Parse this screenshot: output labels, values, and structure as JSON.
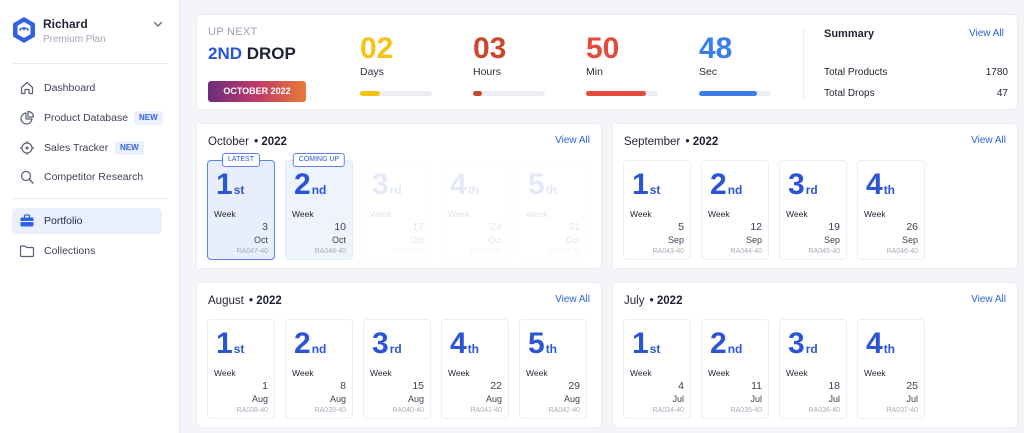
{
  "user": {
    "name": "Richard",
    "plan": "Premium Plan"
  },
  "nav": [
    {
      "label": "Dashboard",
      "icon": "home-icon",
      "badge": ""
    },
    {
      "label": "Product Database",
      "icon": "pie-chart-icon",
      "badge": "NEW"
    },
    {
      "label": "Sales Tracker",
      "icon": "target-icon",
      "badge": "NEW"
    },
    {
      "label": "Competitor Research",
      "icon": "search-icon",
      "badge": ""
    },
    {
      "label": "Portfolio",
      "icon": "briefcase-icon",
      "badge": ""
    },
    {
      "label": "Collections",
      "icon": "folder-icon",
      "badge": ""
    }
  ],
  "upnext": {
    "label": "UP NEXT",
    "title_accent": "2ND",
    "title_rest": "DROP",
    "month": "OCTOBER 2022"
  },
  "countdown": [
    {
      "value": "02",
      "unit": "Days",
      "color": "#f5c218",
      "progress": 0.28
    },
    {
      "value": "03",
      "unit": "Hours",
      "color": "#c9482e",
      "progress": 0.12
    },
    {
      "value": "50",
      "unit": "Min",
      "color": "#e54a3f",
      "progress": 0.84
    },
    {
      "value": "48",
      "unit": "Sec",
      "color": "#3b7ee8",
      "progress": 0.8
    }
  ],
  "summary": {
    "title": "Summary",
    "link": "View All",
    "rows": [
      {
        "label": "Total Products",
        "value": "1780"
      },
      {
        "label": "Total Drops",
        "value": "47"
      }
    ]
  },
  "months": [
    {
      "name": "October",
      "year": "• 2022",
      "link": "View All",
      "weeks": [
        {
          "n": "1",
          "sfx": "st",
          "label": "Week",
          "day": "3",
          "mon": "Oct",
          "code": "RA047-40",
          "state": "latest",
          "tag": "LATEST"
        },
        {
          "n": "2",
          "sfx": "nd",
          "label": "Week",
          "day": "10",
          "mon": "Oct",
          "code": "RA048-40",
          "state": "coming",
          "tag": "COMING UP"
        },
        {
          "n": "3",
          "sfx": "rd",
          "label": "Week",
          "day": "17",
          "mon": "Oct",
          "code": "RA049-40",
          "state": "faded",
          "tag": ""
        },
        {
          "n": "4",
          "sfx": "th",
          "label": "Week",
          "day": "24",
          "mon": "Oct",
          "code": "RA050-40",
          "state": "faded",
          "tag": ""
        },
        {
          "n": "5",
          "sfx": "th",
          "label": "Week",
          "day": "31",
          "mon": "Oct",
          "code": "RA051-40",
          "state": "faded",
          "tag": ""
        }
      ]
    },
    {
      "name": "September",
      "year": "• 2022",
      "link": "View All",
      "weeks": [
        {
          "n": "1",
          "sfx": "st",
          "label": "Week",
          "day": "5",
          "mon": "Sep",
          "code": "RA043-40",
          "state": "normal",
          "tag": ""
        },
        {
          "n": "2",
          "sfx": "nd",
          "label": "Week",
          "day": "12",
          "mon": "Sep",
          "code": "RA044-40",
          "state": "normal",
          "tag": ""
        },
        {
          "n": "3",
          "sfx": "rd",
          "label": "Week",
          "day": "19",
          "mon": "Sep",
          "code": "RA045-40",
          "state": "normal",
          "tag": ""
        },
        {
          "n": "4",
          "sfx": "th",
          "label": "Week",
          "day": "26",
          "mon": "Sep",
          "code": "RA046-40",
          "state": "normal",
          "tag": ""
        }
      ]
    },
    {
      "name": "August",
      "year": "• 2022",
      "link": "View All",
      "weeks": [
        {
          "n": "1",
          "sfx": "st",
          "label": "Week",
          "day": "1",
          "mon": "Aug",
          "code": "RA038-40",
          "state": "normal",
          "tag": ""
        },
        {
          "n": "2",
          "sfx": "nd",
          "label": "Week",
          "day": "8",
          "mon": "Aug",
          "code": "RA039-40",
          "state": "normal",
          "tag": ""
        },
        {
          "n": "3",
          "sfx": "rd",
          "label": "Week",
          "day": "15",
          "mon": "Aug",
          "code": "RA040-40",
          "state": "normal",
          "tag": ""
        },
        {
          "n": "4",
          "sfx": "th",
          "label": "Week",
          "day": "22",
          "mon": "Aug",
          "code": "RA041-40",
          "state": "normal",
          "tag": ""
        },
        {
          "n": "5",
          "sfx": "th",
          "label": "Week",
          "day": "29",
          "mon": "Aug",
          "code": "RA042-40",
          "state": "normal",
          "tag": ""
        }
      ]
    },
    {
      "name": "July",
      "year": "• 2022",
      "link": "View All",
      "weeks": [
        {
          "n": "1",
          "sfx": "st",
          "label": "Week",
          "day": "4",
          "mon": "Jul",
          "code": "RA034-40",
          "state": "normal",
          "tag": ""
        },
        {
          "n": "2",
          "sfx": "nd",
          "label": "Week",
          "day": "11",
          "mon": "Jul",
          "code": "RA035-40",
          "state": "normal",
          "tag": ""
        },
        {
          "n": "3",
          "sfx": "rd",
          "label": "Week",
          "day": "18",
          "mon": "Jul",
          "code": "RA036-40",
          "state": "normal",
          "tag": ""
        },
        {
          "n": "4",
          "sfx": "th",
          "label": "Week",
          "day": "25",
          "mon": "Jul",
          "code": "RA037-40",
          "state": "normal",
          "tag": ""
        }
      ]
    }
  ]
}
